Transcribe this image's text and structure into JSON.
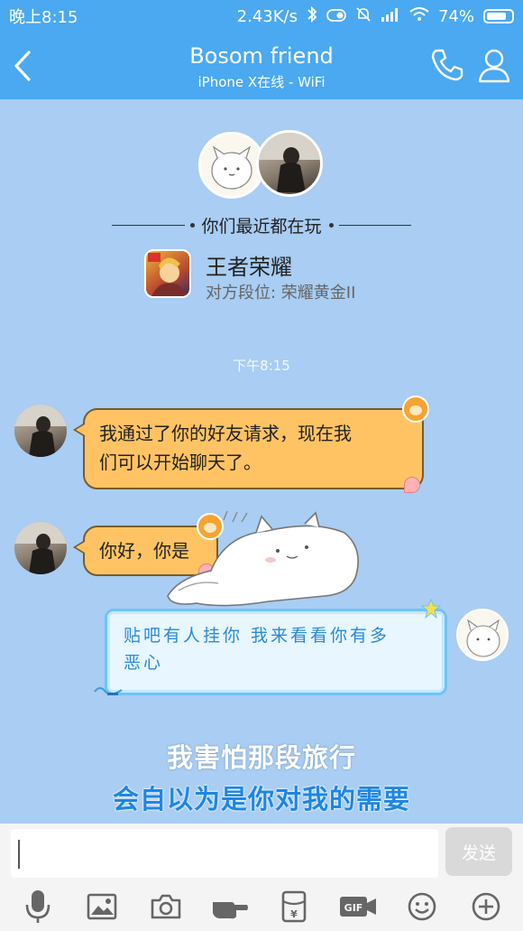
{
  "status_bar": {
    "time": "晚上8:15",
    "net_speed": "2.43K/s",
    "battery": "74%"
  },
  "header": {
    "title": "Bosom friend",
    "subtitle": "iPhone X在线 - WiFi"
  },
  "recent_play": {
    "label": "你们最近都在玩",
    "game_name": "王者荣耀",
    "rank_text": "对方段位: 荣耀黄金II"
  },
  "messages": {
    "timestamp": "下午8:15",
    "m1": {
      "line1": "我通过了你的好友请求，现在我",
      "line2": "们可以开始聊天了。"
    },
    "m2": {
      "text": "你好，你是"
    },
    "m3": {
      "line1": "贴吧有人挂你  我来看看你有多",
      "line2": "恶心"
    }
  },
  "lyrics": {
    "line1": "我害怕那段旅行",
    "line2": "会自以为是你对我的需要"
  },
  "input": {
    "value": "",
    "send_label": "发送"
  },
  "toolbar": {
    "icons": [
      "microphone-icon",
      "image-icon",
      "camera-icon",
      "hand-icon",
      "red-packet-icon",
      "gif-icon",
      "emoji-icon",
      "plus-icon"
    ],
    "gif_text": "GIF"
  },
  "colors": {
    "header": "#4aa9f0",
    "chat_bg": "#a9cdf3",
    "bubble_orange": "#ffc363",
    "bubble_blue_border": "#6fc3f4",
    "lyric_blue": "#1e86e3"
  }
}
